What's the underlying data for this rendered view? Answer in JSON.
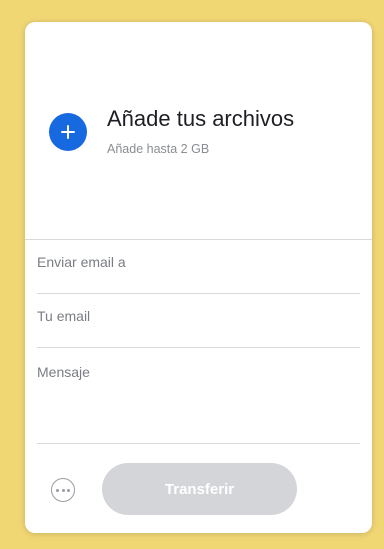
{
  "upload": {
    "title": "Añade tus archivos",
    "subtitle": "Añade hasta 2 GB"
  },
  "form": {
    "recipient_placeholder": "Enviar email a",
    "sender_placeholder": "Tu email",
    "message_placeholder": "Mensaje"
  },
  "footer": {
    "transfer_label": "Transferir",
    "more_icon": "more-options-icon"
  },
  "colors": {
    "background": "#f1d774",
    "accent": "#1769e0",
    "button_disabled": "#d4d5d8"
  }
}
